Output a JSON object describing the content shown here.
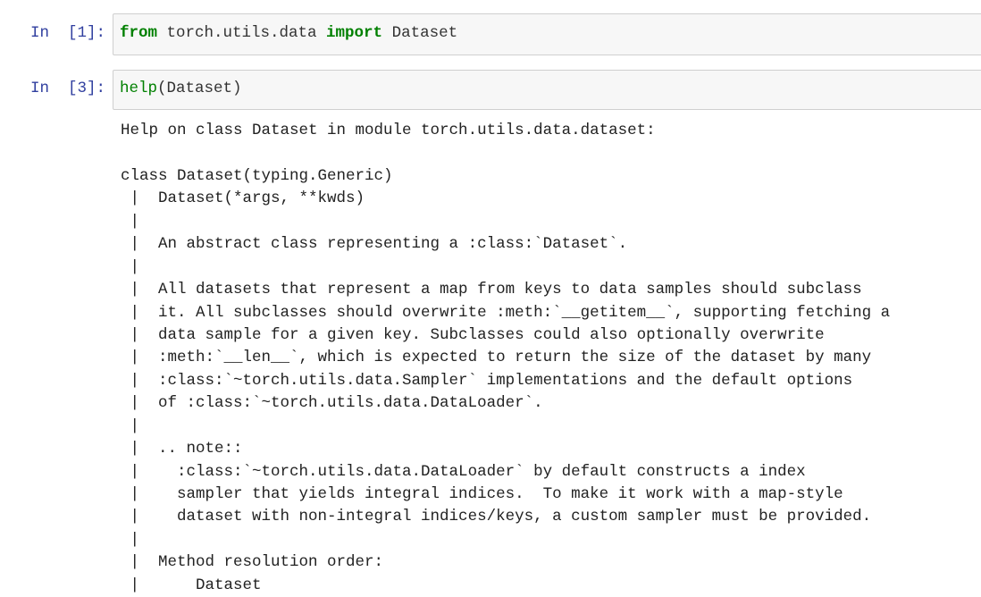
{
  "cells": [
    {
      "prompt": "In  [1]:",
      "code": {
        "kw1": "from",
        "mod": " torch.utils.data ",
        "kw2": "import",
        "name": " Dataset"
      }
    },
    {
      "prompt": "In  [3]:",
      "code": {
        "fn": "help",
        "args": "(Dataset)"
      }
    }
  ],
  "output_lines": [
    "Help on class Dataset in module torch.utils.data.dataset:",
    "",
    "class Dataset(typing.Generic)",
    " |  Dataset(*args, **kwds)",
    " |",
    " |  An abstract class representing a :class:`Dataset`.",
    " |",
    " |  All datasets that represent a map from keys to data samples should subclass",
    " |  it. All subclasses should overwrite :meth:`__getitem__`, supporting fetching a",
    " |  data sample for a given key. Subclasses could also optionally overwrite",
    " |  :meth:`__len__`, which is expected to return the size of the dataset by many",
    " |  :class:`~torch.utils.data.Sampler` implementations and the default options",
    " |  of :class:`~torch.utils.data.DataLoader`.",
    " |",
    " |  .. note::",
    " |    :class:`~torch.utils.data.DataLoader` by default constructs a index",
    " |    sampler that yields integral indices.  To make it work with a map-style",
    " |    dataset with non-integral indices/keys, a custom sampler must be provided.",
    " |",
    " |  Method resolution order:",
    " |      Dataset"
  ],
  "colors": {
    "prompt": "#303f9f",
    "keyword": "#008000",
    "cell_bg": "#f7f7f7"
  }
}
